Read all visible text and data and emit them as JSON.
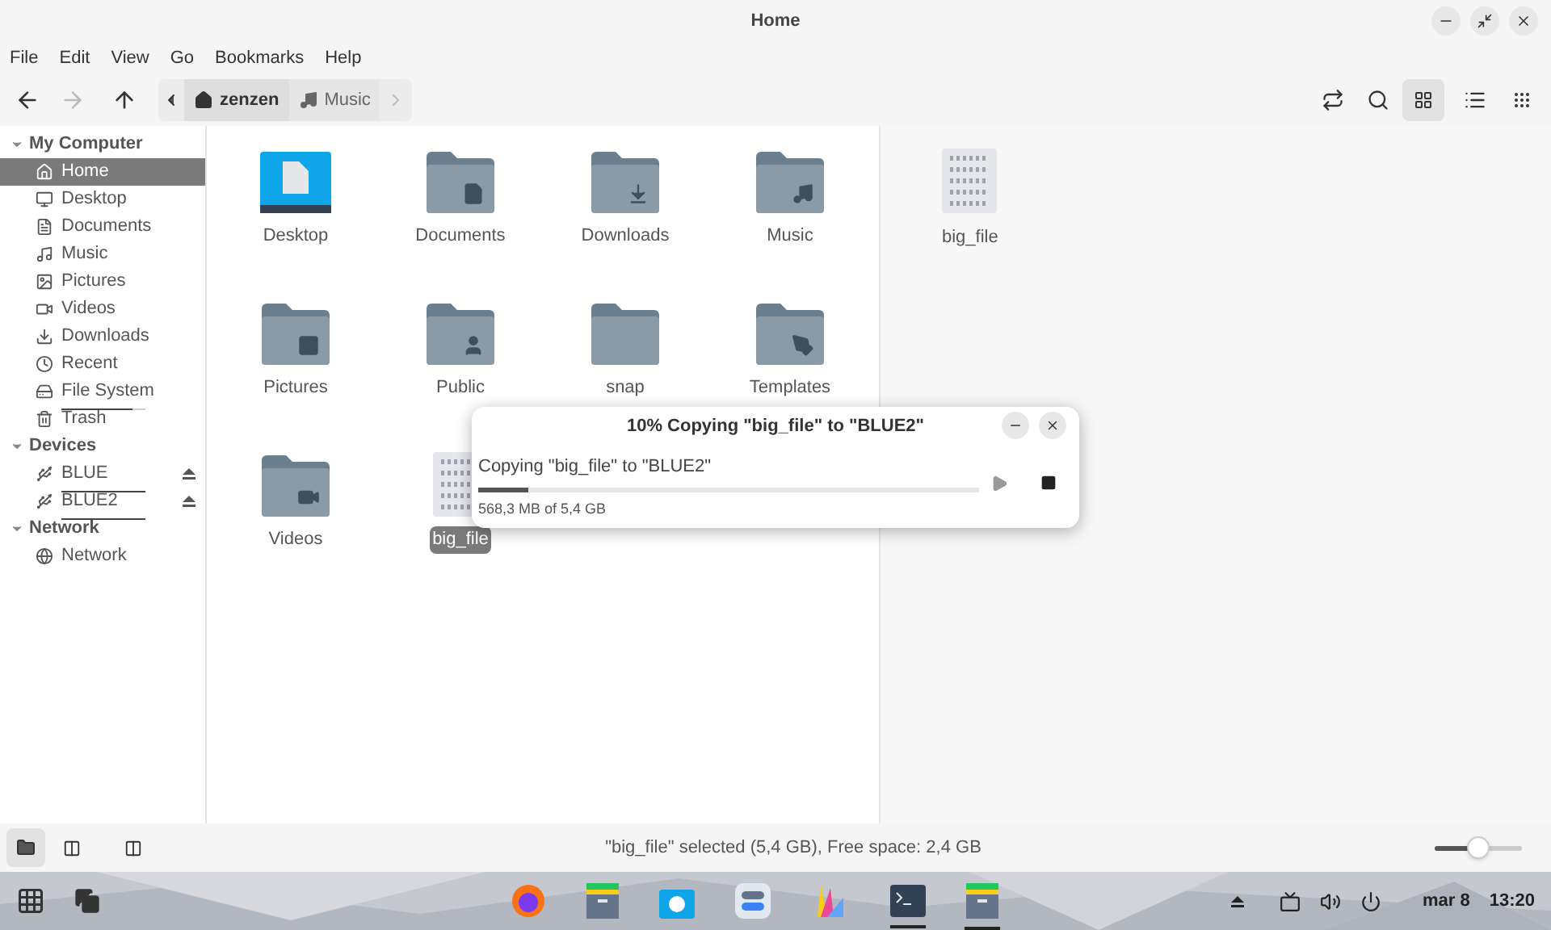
{
  "window": {
    "title": "Home"
  },
  "menu": [
    "File",
    "Edit",
    "View",
    "Go",
    "Bookmarks",
    "Help"
  ],
  "path": [
    {
      "label": "zenzen",
      "kind": "home",
      "selected": true
    },
    {
      "label": "Music",
      "kind": "music",
      "selected": false
    }
  ],
  "sidebar": [
    {
      "label": "My Computer",
      "expanded": true,
      "children": [
        {
          "label": "Home",
          "kind": "home",
          "selected": true
        },
        {
          "label": "Desktop",
          "kind": "desktop",
          "selected": false
        },
        {
          "label": "Documents",
          "kind": "document",
          "selected": false
        },
        {
          "label": "Music",
          "kind": "music",
          "selected": false
        },
        {
          "label": "Pictures",
          "kind": "pictures",
          "selected": false
        },
        {
          "label": "Videos",
          "kind": "videos",
          "selected": false
        },
        {
          "label": "Downloads",
          "kind": "downloads",
          "selected": false
        },
        {
          "label": "Recent",
          "kind": "recent",
          "selected": false
        },
        {
          "label": "File System",
          "kind": "drive",
          "selected": false,
          "level": 0.85
        },
        {
          "label": "Trash",
          "kind": "trash",
          "selected": false
        }
      ]
    },
    {
      "label": "Devices",
      "expanded": true,
      "children": [
        {
          "label": "BLUE",
          "kind": "usb",
          "selected": false,
          "level": 1,
          "eject": true
        },
        {
          "label": "BLUE2",
          "kind": "usb",
          "selected": false,
          "level": 1,
          "eject": true
        }
      ]
    },
    {
      "label": "Network",
      "expanded": true,
      "children": [
        {
          "label": "Network",
          "kind": "network",
          "selected": false
        }
      ]
    }
  ],
  "files": [
    {
      "name": "Desktop",
      "kind": "desktop",
      "selected": false
    },
    {
      "name": "Documents",
      "kind": "document",
      "selected": false
    },
    {
      "name": "Downloads",
      "kind": "downloads",
      "selected": false
    },
    {
      "name": "Music",
      "kind": "music",
      "selected": false
    },
    {
      "name": "Pictures",
      "kind": "pictures",
      "selected": false
    },
    {
      "name": "Public",
      "kind": "public",
      "selected": false
    },
    {
      "name": "snap",
      "kind": "folder",
      "selected": false
    },
    {
      "name": "Templates",
      "kind": "templates",
      "selected": false
    },
    {
      "name": "Videos",
      "kind": "videos",
      "selected": false
    },
    {
      "name": "big_file",
      "kind": "binary",
      "selected": true
    }
  ],
  "preview": {
    "name": "big_file"
  },
  "dialog": {
    "title": "10% Copying \"big_file\" to \"BLUE2\"",
    "message": "Copying \"big_file\" to \"BLUE2\"",
    "level": 0.1,
    "detail": "568,3 MB of 5,4 GB"
  },
  "status_bar": {
    "text": "\"big_file\" selected (5,4 GB), Free space: 2,4 GB",
    "zoom": {
      "level": 0.5
    }
  },
  "taskbar": {
    "apps": [
      {
        "kind": "firefox",
        "running": false
      },
      {
        "kind": "files",
        "running": false
      },
      {
        "kind": "store",
        "running": false
      },
      {
        "kind": "settings",
        "running": false
      },
      {
        "kind": "palette",
        "running": false
      },
      {
        "kind": "terminal",
        "running": true
      },
      {
        "kind": "files",
        "running": true
      }
    ],
    "date": "mar 8",
    "time": "13:20"
  }
}
